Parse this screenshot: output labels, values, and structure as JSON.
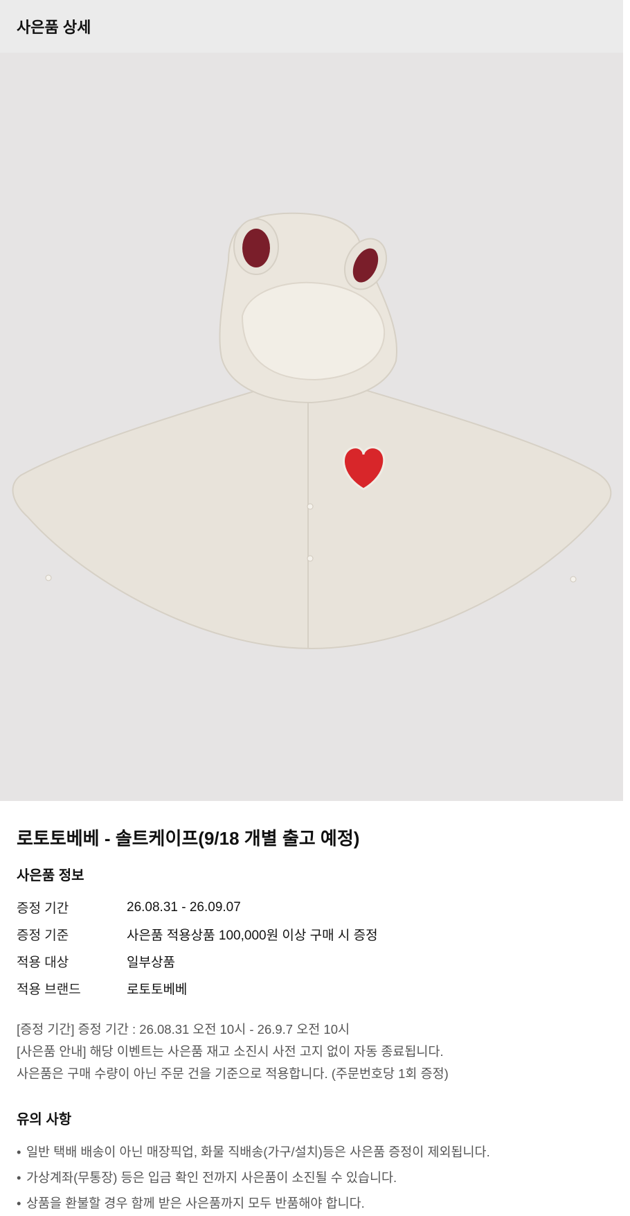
{
  "header": {
    "title": "사은품 상세"
  },
  "product": {
    "image_alt": "cape-product-image",
    "title": "로토토베베 - 솔트케이프(9/18 개별 출고 예정)"
  },
  "gift_info": {
    "section_label": "사은품 정보",
    "rows": [
      {
        "key": "증정 기간",
        "value": "26.08.31 - 26.09.07"
      },
      {
        "key": "증정 기준",
        "value": "사은품 적용상품 100,000원 이상 구매 시 증정"
      },
      {
        "key": "적용 대상",
        "value": "일부상품"
      },
      {
        "key": "적용 브랜드",
        "value": "로토토베베"
      }
    ]
  },
  "notes": [
    "[증정 기간] 증정 기간 : 26.08.31 오전 10시 - 26.9.7 오전 10시",
    "[사은품 안내] 해당 이벤트는 사은품 재고 소진시 사전 고지 없이 자동 종료됩니다.",
    "사은품은 구매 수량이 아닌 주문 건을 기준으로 적용합니다. (주문번호당 1회 증정)"
  ],
  "caution": {
    "title": "유의 사항",
    "bullet": "•",
    "items": [
      "일반 택배 배송이 아닌 매장픽업, 화물 직배송(가구/설치)등은 사은품 증정이 제외됩니다.",
      "가상계좌(무통장) 등은 입금 확인 전까지 사은품이 소진될 수 있습니다.",
      "상품을 환불할 경우 함께 받은 사은품까지 모두 반품해야 합니다."
    ]
  },
  "colors": {
    "header_bg": "#ebebeb",
    "image_bg": "#e6e4e4",
    "cape": "#e8e3da",
    "heart": "#d8262a",
    "ear_lining": "#7a1e2a"
  }
}
